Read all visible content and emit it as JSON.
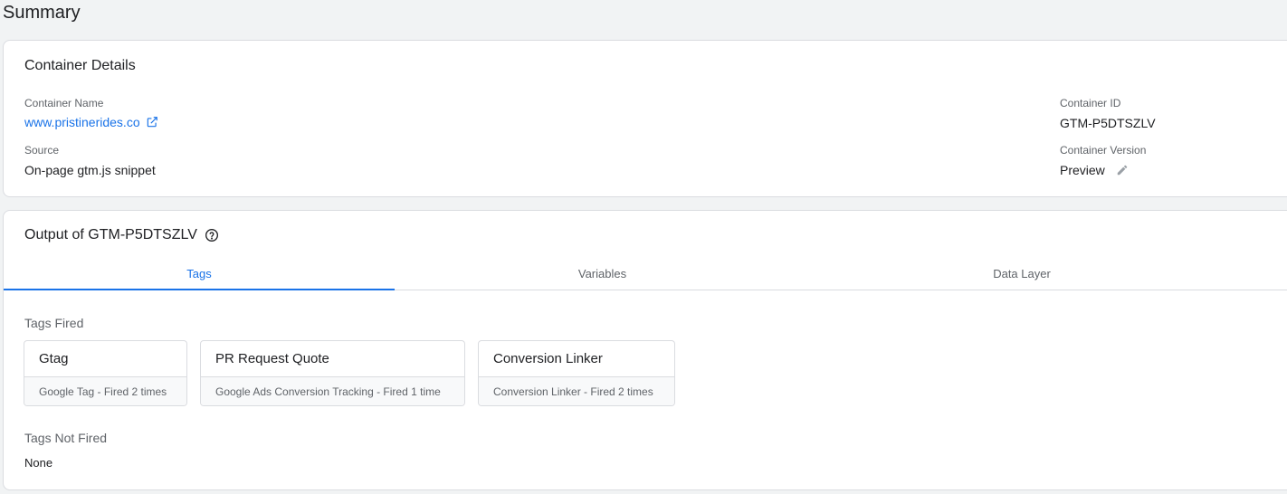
{
  "page": {
    "title": "Summary"
  },
  "details": {
    "title": "Container Details",
    "container_name_label": "Container Name",
    "container_name_value": "www.pristinerides.co",
    "source_label": "Source",
    "source_value": "On-page gtm.js snippet",
    "container_id_label": "Container ID",
    "container_id_value": "GTM-P5DTSZLV",
    "container_version_label": "Container Version",
    "container_version_value": "Preview"
  },
  "output": {
    "title": "Output of GTM-P5DTSZLV",
    "tabs": [
      {
        "label": "Tags",
        "active": true
      },
      {
        "label": "Variables",
        "active": false
      },
      {
        "label": "Data Layer",
        "active": false
      }
    ],
    "tags_fired_label": "Tags Fired",
    "tags_fired": [
      {
        "name": "Gtag",
        "detail": "Google Tag - Fired 2 times"
      },
      {
        "name": "PR Request Quote",
        "detail": "Google Ads Conversion Tracking - Fired 1 time"
      },
      {
        "name": "Conversion Linker",
        "detail": "Conversion Linker - Fired 2 times"
      }
    ],
    "tags_not_fired_label": "Tags Not Fired",
    "tags_not_fired_value": "None"
  },
  "icons": {
    "external_link": "open-in-new-icon",
    "edit": "pencil-icon",
    "help": "help-circle-icon"
  },
  "colors": {
    "accent": "#1a73e8",
    "background": "#f1f3f4",
    "border": "#dadce0"
  }
}
